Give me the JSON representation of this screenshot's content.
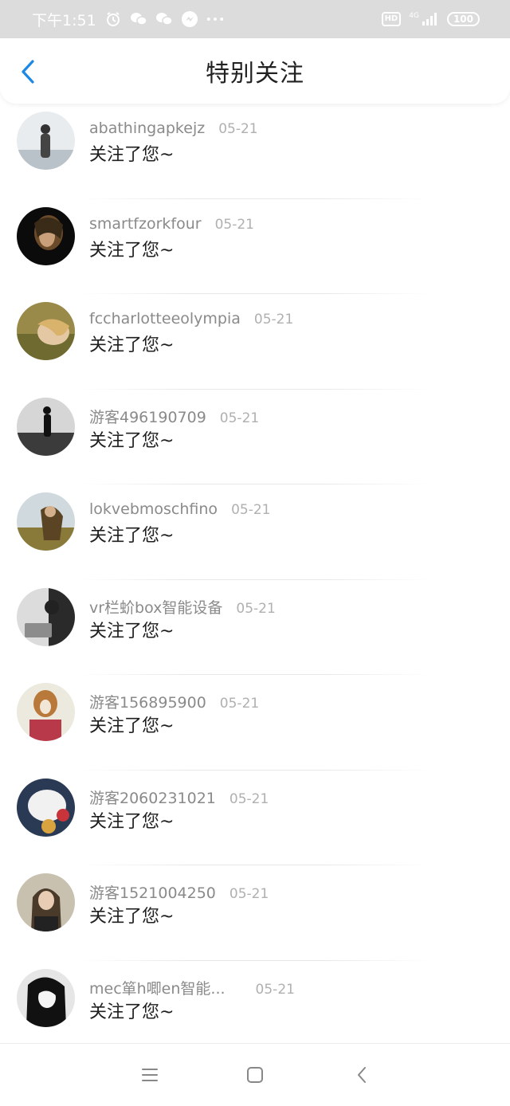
{
  "status_bar": {
    "time": "下午1:51",
    "icons_left": [
      "alarm-icon",
      "wechat-icon",
      "wechat-icon",
      "messenger-icon",
      "more-dots-icon"
    ],
    "hd_label": "HD",
    "network_label": "4G",
    "battery_level": "100"
  },
  "header": {
    "title": "特别关注",
    "back_icon": "chevron-left-icon"
  },
  "items": [
    {
      "username": "abathingapkejz",
      "date": "05-21",
      "message": "关注了您~"
    },
    {
      "username": "smartfzorkfour",
      "date": "05-21",
      "message": "关注了您~"
    },
    {
      "username": "fccharlotteeolympia",
      "date": "05-21",
      "message": "关注了您~"
    },
    {
      "username": "游客496190709",
      "date": "05-21",
      "message": "关注了您~"
    },
    {
      "username": "lokvebmoschfino",
      "date": "05-21",
      "message": "关注了您~"
    },
    {
      "username": "vr栏蚧box智能设备",
      "date": "05-21",
      "message": "关注了您~"
    },
    {
      "username": "游客156895900",
      "date": "05-21",
      "message": "关注了您~"
    },
    {
      "username": "游客2060231021",
      "date": "05-21",
      "message": "关注了您~"
    },
    {
      "username": "游客1521004250",
      "date": "05-21",
      "message": "关注了您~"
    },
    {
      "username": "mec箪h唧en智能...",
      "date": "05-21",
      "message": "关注了您~"
    }
  ],
  "colors": {
    "status_bar_bg": "#dcdcdc",
    "accent_blue": "#1e88e5",
    "username_gray": "#8a8a8a",
    "date_gray": "#b0b0b0"
  },
  "nav_bar": {
    "icons": [
      "menu-icon",
      "home-square-icon",
      "back-triangle-icon"
    ]
  }
}
